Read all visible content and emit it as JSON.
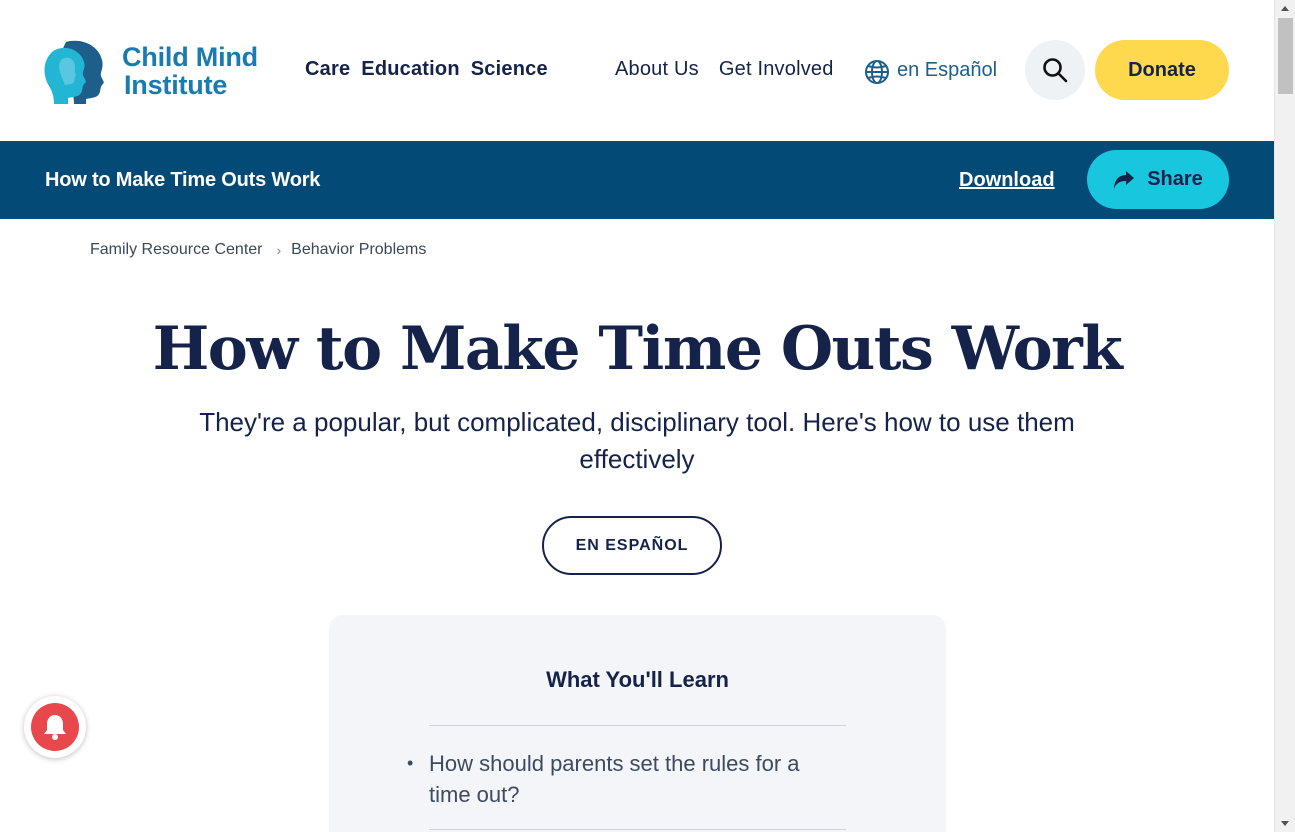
{
  "header": {
    "logo": {
      "line1": "Child Mind",
      "line2": "Institute",
      "icon": "heads-profile-icon"
    },
    "main_nav": [
      "Care",
      "Education",
      "Science"
    ],
    "secondary_nav": [
      "About Us",
      "Get Involved"
    ],
    "language_link": {
      "label": "en Español",
      "icon": "globe-icon"
    },
    "search": {
      "icon": "search-icon"
    },
    "donate_label": "Donate"
  },
  "article_bar": {
    "title": "How to Make Time Outs Work",
    "download_label": "Download",
    "share_label": "Share",
    "share_icon": "share-arrow-icon"
  },
  "breadcrumb": [
    "Family Resource Center",
    "Behavior Problems"
  ],
  "article": {
    "title": "How to Make Time Outs Work",
    "subtitle": "They're a popular, but complicated, disciplinary tool. Here's how to use them effectively",
    "espanol_label": "EN ESPAÑOL"
  },
  "learn_box": {
    "title": "What You'll Learn",
    "items": [
      "How should parents set the rules for a time out?"
    ]
  },
  "notification": {
    "icon": "bell-icon"
  },
  "colors": {
    "brand_blue": "#1a7bb0",
    "navy": "#15234a",
    "article_bar_bg": "#034a77",
    "donate_yellow": "#ffd94d",
    "share_cyan": "#18c7de",
    "bell_red": "#e8474c"
  }
}
